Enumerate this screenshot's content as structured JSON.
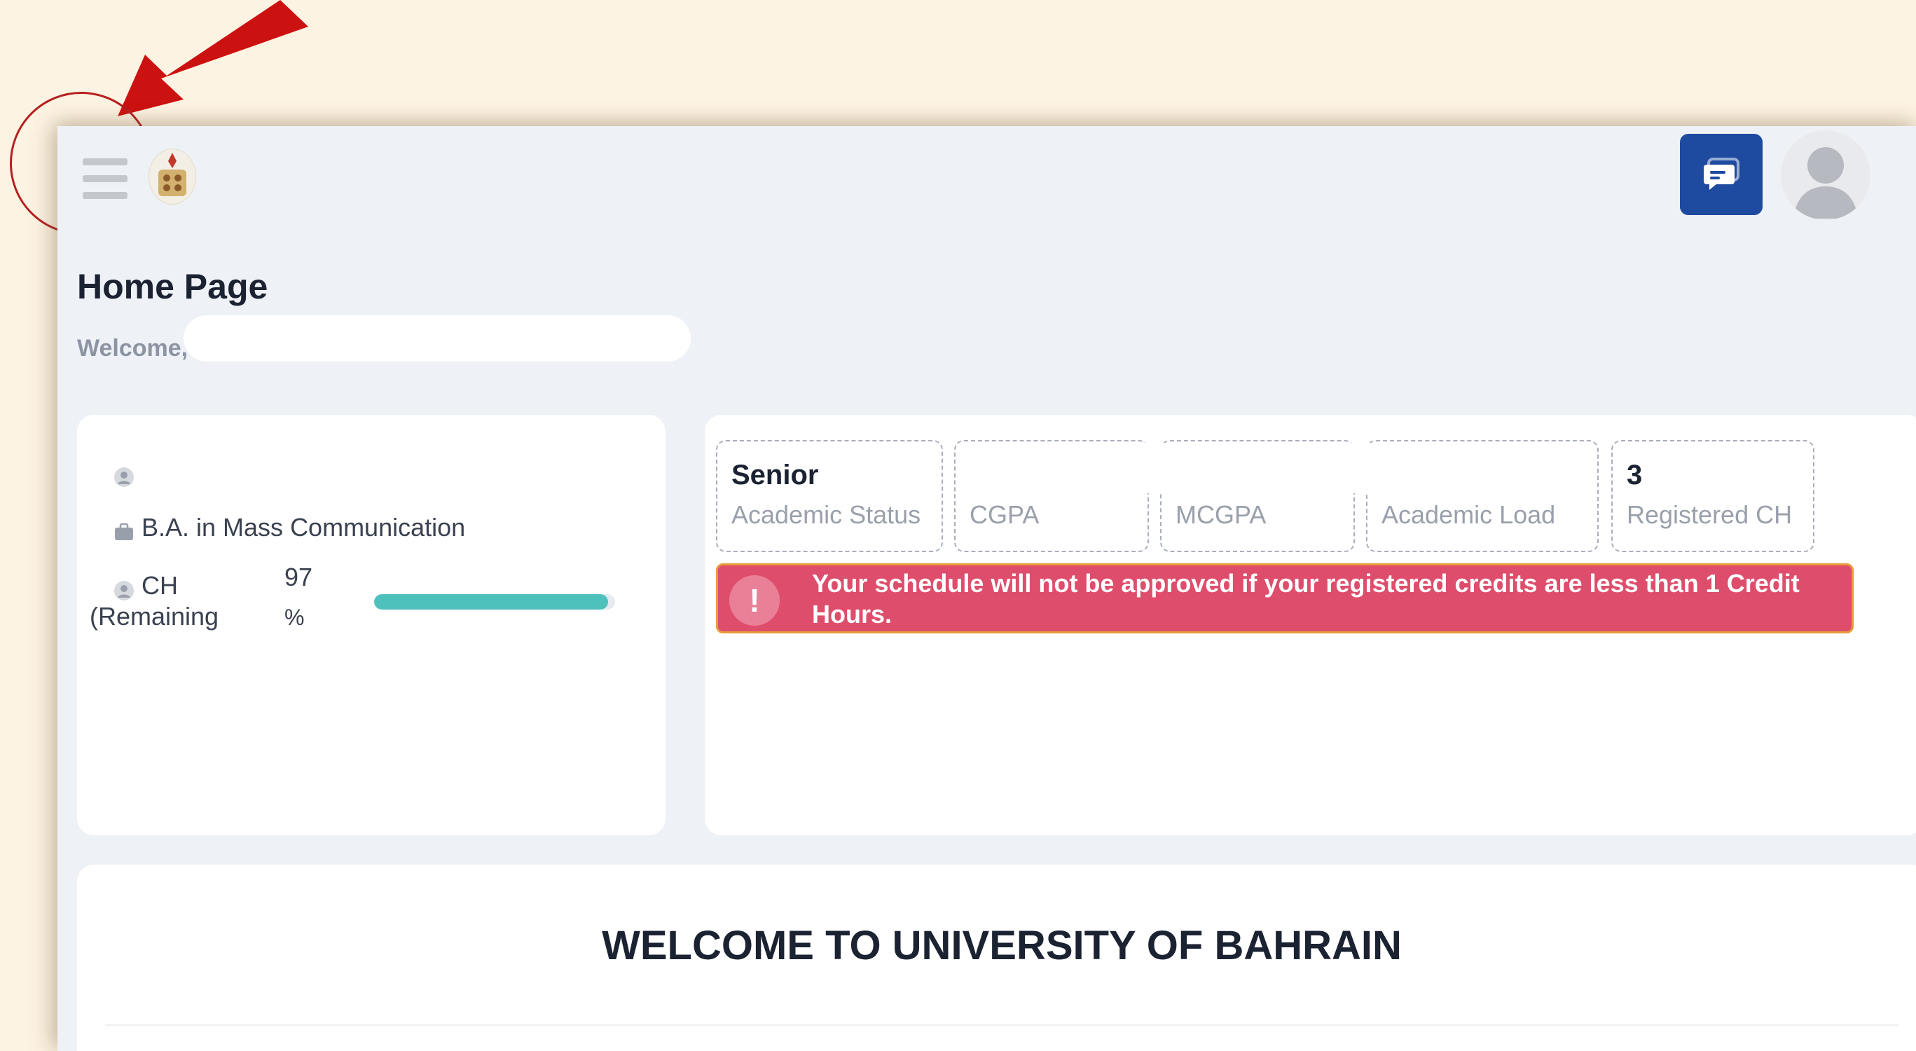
{
  "header": {
    "menu_icon": "hamburger-menu-icon",
    "logo_icon": "university-seal-logo",
    "chat_icon": "chat-message-icon",
    "avatar_icon": "user-avatar-icon"
  },
  "page": {
    "title": "Home Page",
    "welcome_label": "Welcome,"
  },
  "profile": {
    "program": "B.A. in Mass Communication",
    "ch_label": "CH\n(Remaining",
    "ch_percent": "97\n%",
    "progress_fraction": 0.97
  },
  "stats": [
    {
      "value": "Senior",
      "label": "Academic Status"
    },
    {
      "value": "",
      "label": "CGPA"
    },
    {
      "value": "",
      "label": "MCGPA"
    },
    {
      "value": "",
      "label": "Academic Load"
    },
    {
      "value": "3",
      "label": "Registered CH"
    }
  ],
  "alert": {
    "icon": "exclamation-icon",
    "message": "Your schedule will not be approved if your registered credits are less than 1 Credit Hours."
  },
  "main": {
    "heading": "WELCOME TO UNIVERSITY OF BAHRAIN"
  },
  "colors": {
    "background": "#fdf3e3",
    "primary": "#1e4a9f",
    "alert": "#de4e6c",
    "progress": "#4fc1bd",
    "annotation": "#cc1111"
  }
}
